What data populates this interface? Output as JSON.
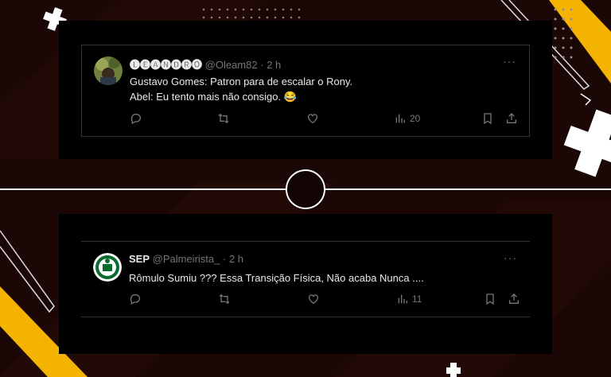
{
  "tweets": [
    {
      "display_name": "🅛🅔🅐🅝🅓🅡🅞",
      "handle": "@Oleam82",
      "sep": "·",
      "time": "2 h",
      "text_line1": "Gustavo Gomes: Patron para de escalar o Rony.",
      "text_line2": "Abel: Eu tento mais não consigo. 😂",
      "views": "20"
    },
    {
      "display_name": "SEP",
      "handle": "@Palmeirista_",
      "sep": "·",
      "time": "2 h",
      "text_line1": "Rômulo Sumiu ??? Essa Transição Física, Não acaba Nunca ....",
      "views": "11"
    }
  ],
  "more_glyph": "···",
  "icons": [
    "reply-icon",
    "retweet-icon",
    "like-icon",
    "views-icon",
    "bookmark-icon",
    "share-icon",
    "more-icon"
  ],
  "colors": {
    "accent_yellow": "#f5b301",
    "card_bg": "#000000",
    "muted_text": "#71767b",
    "text": "#e7e9ea"
  }
}
